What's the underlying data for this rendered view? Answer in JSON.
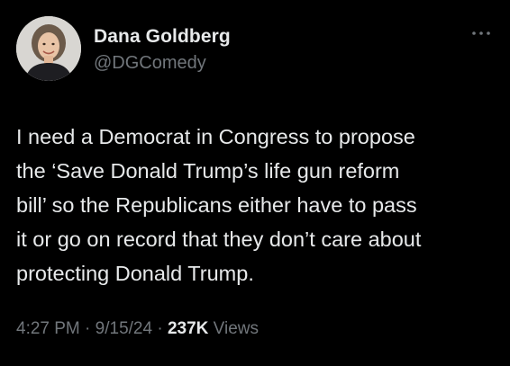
{
  "author": {
    "display_name": "Dana Goldberg",
    "handle": "@DGComedy"
  },
  "post": {
    "lines": [
      "I need a Democrat in Congress to propose",
      "the ‘Save Donald Trump’s life gun reform",
      "bill’ so the Republicans either have to pass",
      "it or go on record that they don’t care about",
      "protecting Donald Trump."
    ]
  },
  "meta": {
    "time": "4:27 PM",
    "separator": "·",
    "date": "9/15/24",
    "views_count": "237K",
    "views_label": "Views"
  },
  "icons": {
    "more": "more-horizontal-icon",
    "avatar": "profile-photo"
  },
  "colors": {
    "background": "#000000",
    "primary_text": "#e7e9ea",
    "secondary_text": "#71767b"
  }
}
